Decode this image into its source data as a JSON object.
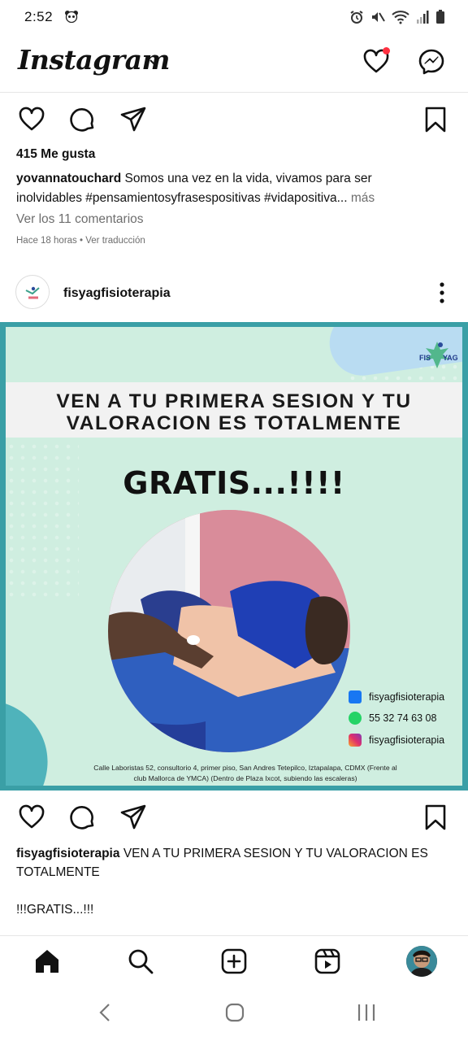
{
  "status_bar": {
    "time": "2:52",
    "icons": [
      "panda-icon",
      "alarm-icon",
      "mute-icon",
      "wifi-icon",
      "signal-icon",
      "battery-icon"
    ]
  },
  "header": {
    "logo": "Instagram",
    "icons": [
      "chevron-down-icon",
      "heart-icon",
      "messenger-icon"
    ],
    "notification_color": "#ff3040"
  },
  "previous_post": {
    "likes": "415 Me gusta",
    "username": "yovannatouchard",
    "caption_line1": "Somos una vez en la vida, vivamos para ser",
    "caption_line2": "inolvidables #pensamientosyfrasespositivas #vidapositiva...",
    "more": "más",
    "comments_link": "Ver los 11 comentarios",
    "time": "Hace 18 horas",
    "separator": "•",
    "translate": "Ver traducción"
  },
  "post": {
    "username": "fisyagfisioterapia",
    "image": {
      "brand_fis": "FIS",
      "brand_yag": "YAG",
      "banner_line1": "VEN A TU PRIMERA SESION Y TU",
      "banner_line2": "VALORACION ES TOTALMENTE",
      "gratis": "GRATIS...!!!!",
      "contacts": [
        {
          "icon": "facebook-icon",
          "text": "fisyagfisioterapia"
        },
        {
          "icon": "whatsapp-icon",
          "text": "55 32 74 63 08"
        },
        {
          "icon": "instagram-icon",
          "text": "fisyagfisioterapia"
        }
      ],
      "address_line1": "Calle Laboristas 52, consultorio 4, primer piso, San Andres Tetepilco, Iztapalapa, CDMX (Frente al",
      "address_line2": "club Mallorca de YMCA) (Dentro de Plaza Ixcot, subiendo las escaleras)",
      "colors": {
        "frame": "#3a9fa6",
        "background": "#cfeee0",
        "banner": "#f2f2f2"
      }
    },
    "caption_username": "fisyagfisioterapia",
    "caption_line1": "VEN A TU PRIMERA SESION Y TU VALORACION ES",
    "caption_line2": "TOTALMENTE",
    "caption_line3": "!!!GRATIS...!!!"
  },
  "bottom_nav": [
    "home-icon",
    "search-icon",
    "add-post-icon",
    "reels-icon",
    "profile-avatar"
  ],
  "system_nav": [
    "back-icon",
    "home-circle-icon",
    "recents-icon"
  ]
}
